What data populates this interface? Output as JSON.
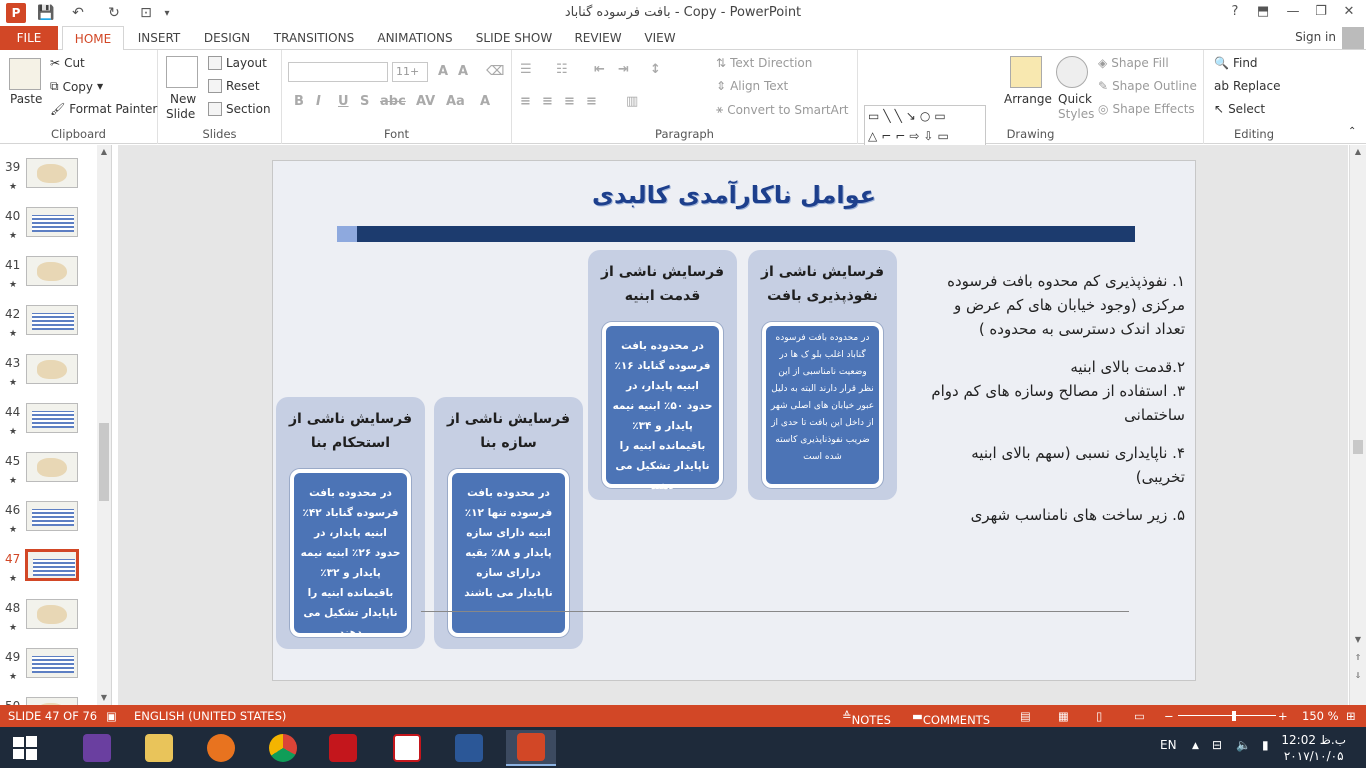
{
  "window": {
    "title": "بافت فرسوده گناباد - Copy - PowerPoint",
    "help": "?",
    "controls": [
      "—",
      "❐",
      "✕"
    ]
  },
  "tabs": [
    "FILE",
    "HOME",
    "INSERT",
    "DESIGN",
    "TRANSITIONS",
    "ANIMATIONS",
    "SLIDE SHOW",
    "REVIEW",
    "VIEW"
  ],
  "active_tab": "HOME",
  "signin": "Sign in",
  "ribbon": {
    "clipboard": {
      "label": "Clipboard",
      "paste": "Paste",
      "cut": "Cut",
      "copy": "Copy",
      "format_painter": "Format Painter"
    },
    "slides": {
      "label": "Slides",
      "new_slide_1": "New",
      "new_slide_2": "Slide",
      "layout": "Layout",
      "reset": "Reset",
      "section": "Section"
    },
    "font": {
      "label": "Font",
      "size": "11+"
    },
    "paragraph": {
      "label": "Paragraph",
      "text_direction": "Text Direction",
      "align_text": "Align Text",
      "convert_smartart": "Convert to SmartArt"
    },
    "drawing": {
      "label": "Drawing",
      "arrange": "Arrange",
      "quick_styles_1": "Quick",
      "quick_styles_2": "Styles",
      "shape_fill": "Shape Fill",
      "shape_outline": "Shape Outline",
      "shape_effects": "Shape Effects"
    },
    "editing": {
      "label": "Editing",
      "find": "Find",
      "replace": "Replace",
      "select": "Select"
    }
  },
  "slides_panel": [
    {
      "num": "39",
      "type": "map"
    },
    {
      "num": "40",
      "type": "table"
    },
    {
      "num": "41",
      "type": "map"
    },
    {
      "num": "42",
      "type": "table"
    },
    {
      "num": "43",
      "type": "map"
    },
    {
      "num": "44",
      "type": "table"
    },
    {
      "num": "45",
      "type": "map"
    },
    {
      "num": "46",
      "type": "table"
    },
    {
      "num": "47",
      "type": "selected"
    },
    {
      "num": "48",
      "type": "map"
    },
    {
      "num": "49",
      "type": "table"
    },
    {
      "num": "50",
      "type": "map"
    }
  ],
  "slide": {
    "title": "عوامل ناکارآمدی کالبدی",
    "columns": [
      {
        "header": "فرسایش ناشی از نفوذپذیری بافت",
        "body": "در محدوده بافت فرسوده گناباد اغلب بلو ک ها در وضعیت نامناسبی از این نظر قرار دارند البته به دلیل عبور خیابان های اصلی شهر از داخل این بافت تا حدی از ضریب نفوذناپذیری کاسته شده است"
      },
      {
        "header": "فرسایش ناشی از قدمت ابنیه",
        "body": "در محدوده بافت فرسوده گناباد ۱۶٪ ابنیه پایدار، در حدود ۵۰٪ ابنیه نیمه پایدار و ۳۴٪ باقیمانده ابنیه را ناپایدار تشکیل می دهند"
      },
      {
        "header": "فرسایش ناشی از سازه بنا",
        "body": "در محدوده بافت فرسوده تنها ۱۲٪ ابنیه دارای سازه پایدار و ۸۸٪ بقیه درارای سازه ناپایدار می باشند"
      },
      {
        "header": "فرسایش ناشی از استحکام بنا",
        "body": "در محدوده بافت فرسوده گناباد ۴۲٪ ابنیه پایدار، در حدود ۲۶٪ ابنیه نیمه پایدار و ۳۲٪ باقیمانده ابنیه را ناپایدار تشکیل می دهند"
      }
    ],
    "list": [
      "۱. نفوذپذیری کم محدوه بافت فرسوده مرکزی (وجود خیابان های کم عرض و تعداد اندک دسترسی به محدوده )",
      "۲.قدمت بالای ابنیه",
      "۳. استفاده از مصالح وسازه های کم دوام ساختمانی",
      "۴. ناپایداری نسبی (سهم بالای ابنیه تخریبی)",
      "۵. زیر ساخت های نامناسب شهری"
    ]
  },
  "status": {
    "slide": "SLIDE 47 OF 76",
    "language": "ENGLISH (UNITED STATES)",
    "notes": "NOTES",
    "comments": "COMMENTS",
    "zoom": "150 %"
  },
  "taskbar": {
    "lang": "EN",
    "time": "12:02 ب.ظ",
    "date": "۲۰۱۷/۱۰/۰۵"
  },
  "colors": {
    "accent": "#d24726",
    "slide_title": "#1d3f8c",
    "title_bar": "#1c3b6e",
    "box_fill": "#4c74b6",
    "column_fill": "#c6cfe3"
  }
}
